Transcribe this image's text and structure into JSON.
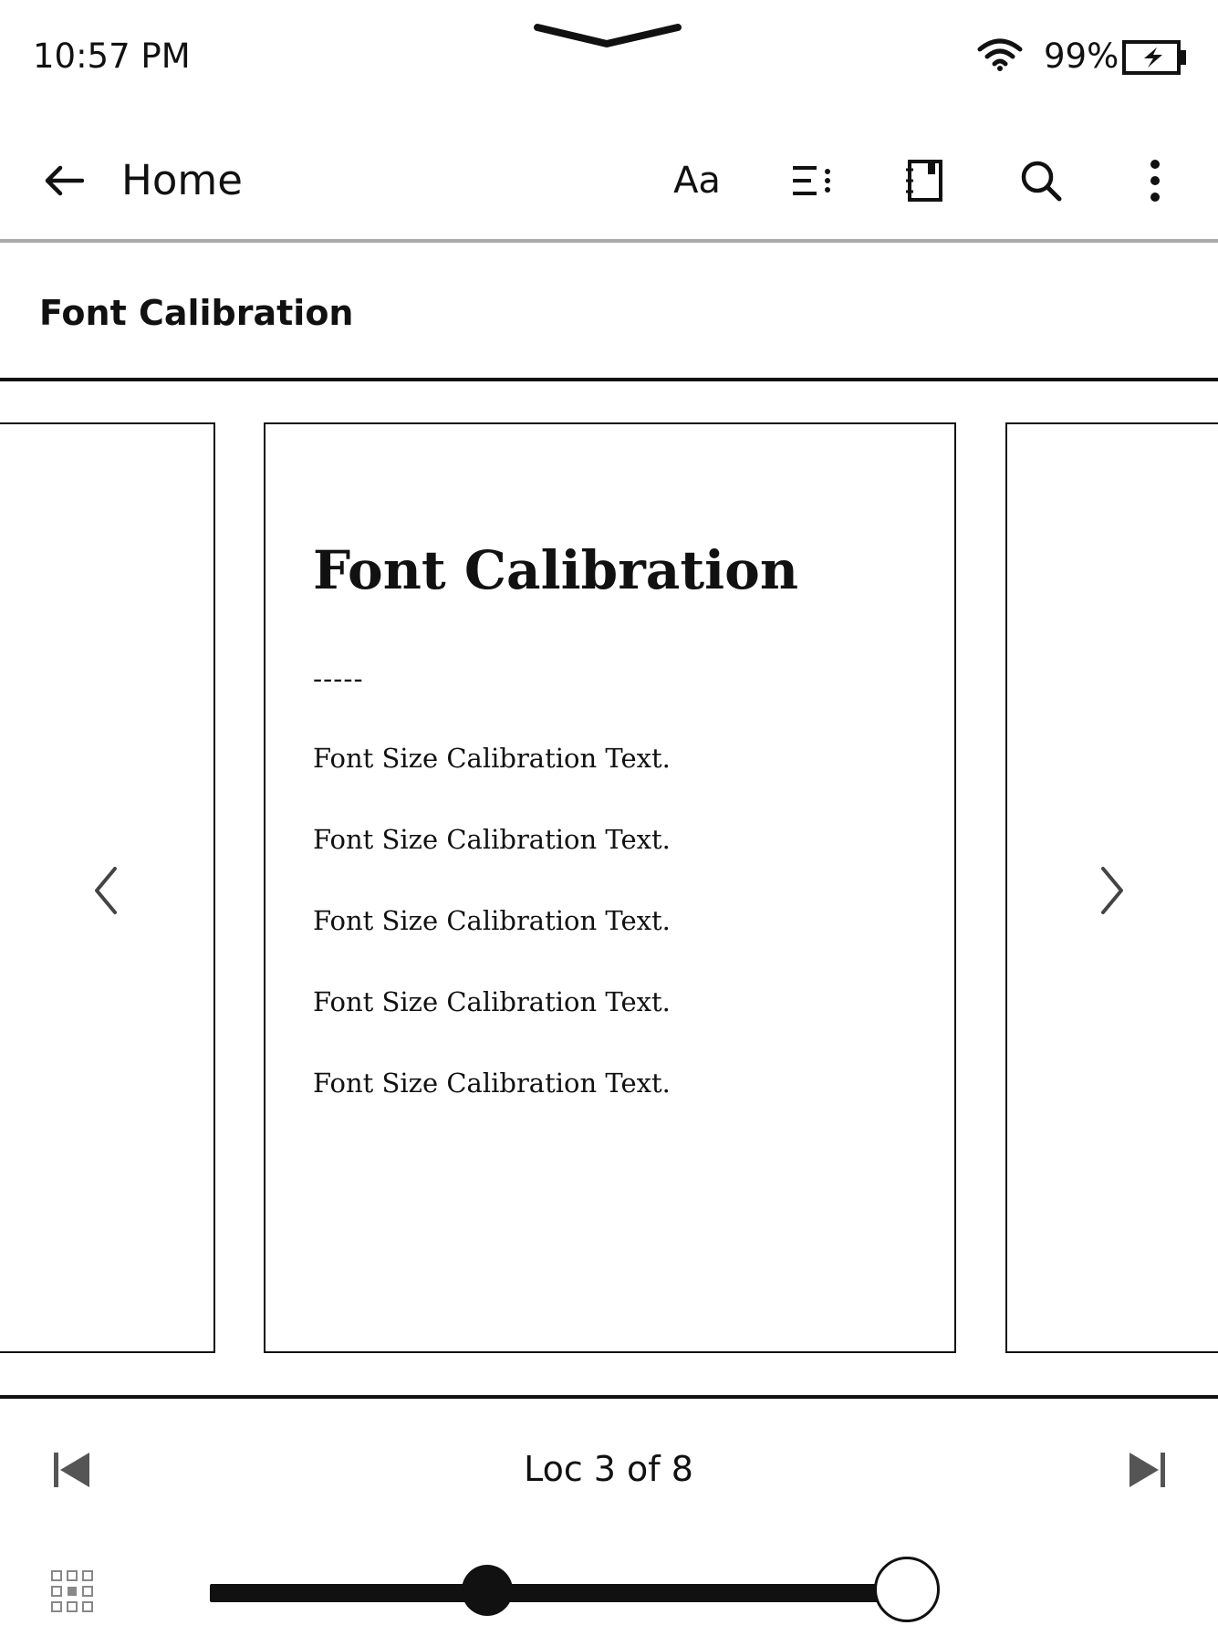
{
  "status_bar": {
    "time": "10:57 PM",
    "battery_percent": "99%",
    "icons": [
      "pull-down-chevron-icon",
      "wifi-icon",
      "battery-charging-icon"
    ]
  },
  "toolbar": {
    "back_icon": "arrow-left-icon",
    "home_label": "Home",
    "font_settings_label": "Aa",
    "icons": [
      "contents-list-icon",
      "notebook-icon",
      "search-icon",
      "more-vertical-icon"
    ]
  },
  "book": {
    "title": "Font Calibration"
  },
  "page": {
    "heading": "Font Calibration",
    "separator": "-----",
    "lines": [
      "Font Size Calibration Text.",
      "Font Size Calibration Text.",
      "Font Size Calibration Text.",
      "Font Size Calibration Text.",
      "Font Size Calibration Text."
    ]
  },
  "navigation": {
    "prev_icon": "chevron-left-icon",
    "next_icon": "chevron-right-icon"
  },
  "footer": {
    "location": "Loc 3 of 8",
    "skip_start_icon": "skip-to-start-icon",
    "skip_end_icon": "skip-to-end-icon",
    "grid_icon": "page-grid-icon",
    "progress": {
      "current": 3,
      "total": 8,
      "current_fraction": 0.33,
      "end_fraction": 0.83
    }
  },
  "colors": {
    "ink": "#111111",
    "paper": "#ffffff",
    "divider": "#aaaaaa"
  }
}
